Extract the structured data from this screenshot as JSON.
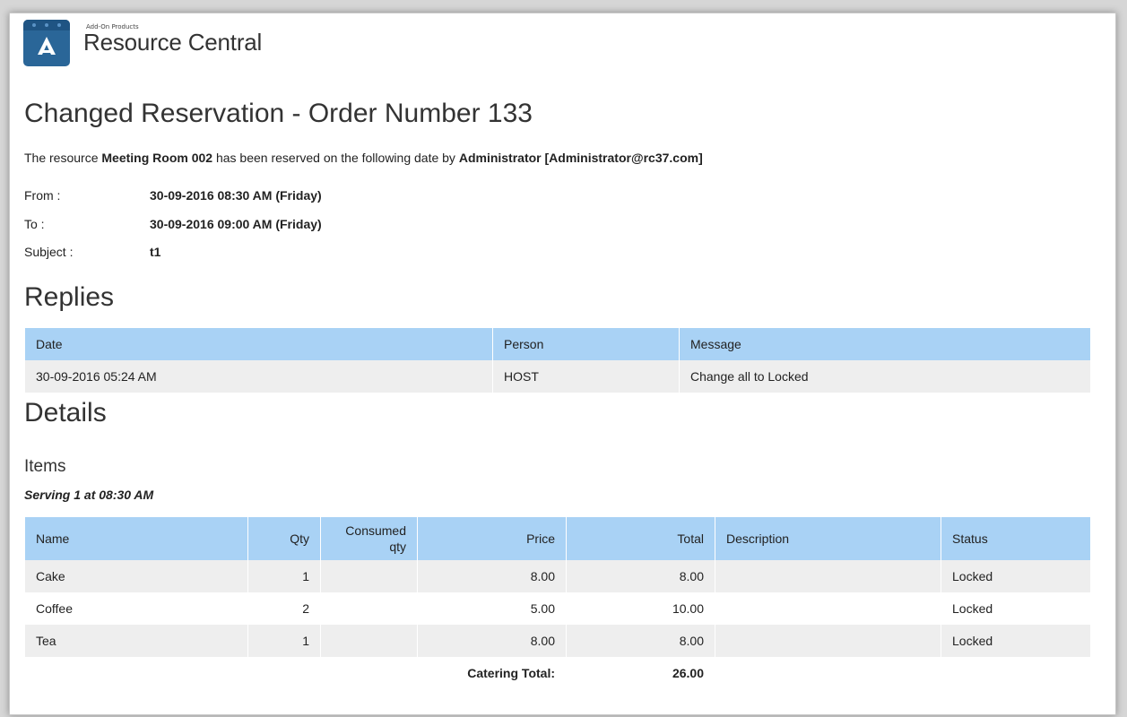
{
  "brand": {
    "small": "Add-On Products",
    "name": "Resource Central"
  },
  "title": "Changed Reservation - Order Number 133",
  "intro": {
    "p1": "The resource ",
    "resource": "Meeting Room 002",
    "p2": " has been reserved on the following date by ",
    "by": "Administrator [Administrator@rc37.com]"
  },
  "info": {
    "from_label": "From :",
    "from_value": "30-09-2016 08:30 AM (Friday)",
    "to_label": "To :",
    "to_value": "30-09-2016 09:00 AM (Friday)",
    "subject_label": "Subject :",
    "subject_value": "t1"
  },
  "replies": {
    "heading": "Replies",
    "headers": [
      "Date",
      "Person",
      "Message"
    ],
    "rows": [
      [
        "30-09-2016 05:24 AM",
        "HOST",
        "Change all to Locked"
      ]
    ]
  },
  "details": {
    "heading": "Details",
    "items_heading": "Items",
    "serving": "Serving 1 at 08:30 AM",
    "headers": [
      "Name",
      "Qty",
      "Consumed qty",
      "Price",
      "Total",
      "Description",
      "Status"
    ],
    "rows": [
      [
        "Cake",
        "1",
        "",
        "8.00",
        "8.00",
        "",
        "Locked"
      ],
      [
        "Coffee",
        "2",
        "",
        "5.00",
        "10.00",
        "",
        "Locked"
      ],
      [
        "Tea",
        "1",
        "",
        "8.00",
        "8.00",
        "",
        "Locked"
      ]
    ],
    "total_label": "Catering Total:",
    "total_value": "26.00"
  },
  "colors": {
    "header_bg": "#a9d2f5",
    "row_alt": "#eeeeee",
    "logo": "#2a6698"
  }
}
